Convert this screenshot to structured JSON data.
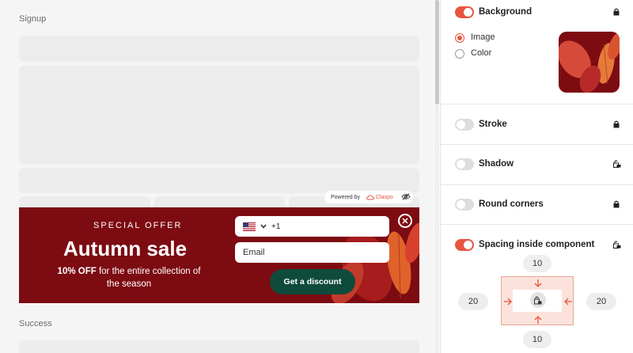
{
  "preview": {
    "signup_label": "Signup",
    "success_label": "Success",
    "powered": {
      "prefix": "Powered by",
      "brand": "Claspo"
    },
    "banner": {
      "special": "SPECIAL OFFER",
      "title": "Autumn sale",
      "offer_bold": "10% OFF",
      "offer_rest": " for the entire collection of the season",
      "phone_code": "+1",
      "email_placeholder": "Email",
      "cta": "Get a discount",
      "bg_color": "#7d0b12",
      "cta_color": "#0f4b3a"
    }
  },
  "panel": {
    "accent": "#e8553f",
    "background": {
      "label": "Background",
      "enabled": true,
      "lock": "lock-closed-icon",
      "options": [
        {
          "label": "Image",
          "selected": true
        },
        {
          "label": "Color",
          "selected": false
        }
      ]
    },
    "stroke": {
      "label": "Stroke",
      "enabled": false,
      "lock": "lock-closed-icon"
    },
    "shadow": {
      "label": "Shadow",
      "enabled": false,
      "lock": "lock-open-icon"
    },
    "round_corners": {
      "label": "Round corners",
      "enabled": false,
      "lock": "lock-closed-icon"
    },
    "spacing": {
      "label": "Spacing inside component",
      "enabled": true,
      "lock": "lock-open-icon",
      "top": "10",
      "left": "20",
      "right": "20",
      "bottom": "10"
    }
  }
}
